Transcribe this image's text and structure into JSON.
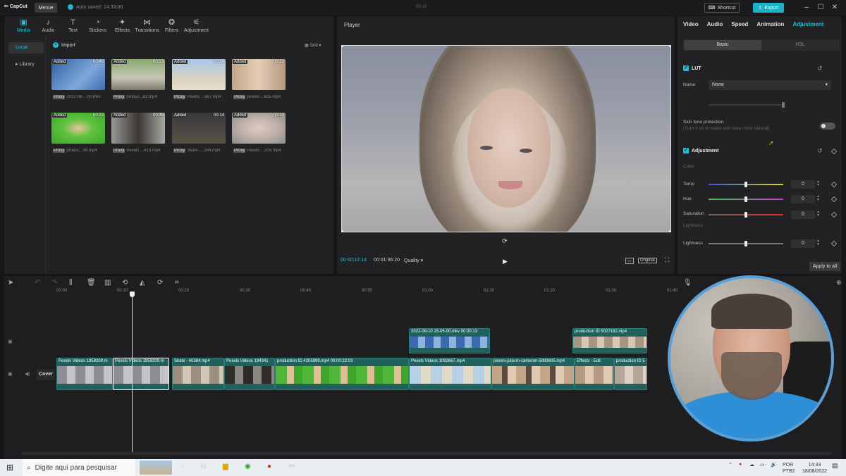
{
  "titlebar": {
    "app_name": "CapCut",
    "menu_label": "Menu",
    "autosave": "Auto saved: 14:33:00",
    "window_title": "00:13",
    "shortcut_label": "Shortcut",
    "export_label": "Export"
  },
  "tools": [
    {
      "icon": "media-icon",
      "label": "Media"
    },
    {
      "icon": "audio-icon",
      "label": "Audio"
    },
    {
      "icon": "text-icon",
      "label": "Text"
    },
    {
      "icon": "stickers-icon",
      "label": "Stickers"
    },
    {
      "icon": "effects-icon",
      "label": "Effects"
    },
    {
      "icon": "transitions-icon",
      "label": "Transitions"
    },
    {
      "icon": "filters-icon",
      "label": "Filters"
    },
    {
      "icon": "adjustment-icon",
      "label": "Adjustment"
    }
  ],
  "sidebar": {
    "local": "Local",
    "library": "Library"
  },
  "media": {
    "import_label": "Import",
    "view_label": "Grid",
    "items": [
      {
        "badge": "Added",
        "duration": "00:48",
        "proxy": "Proxy",
        "name": "2022-08-...00.mkv"
      },
      {
        "badge": "Added",
        "duration": "00:13",
        "proxy": "Proxy",
        "name": "produc...82.mp4"
      },
      {
        "badge": "Added",
        "duration": "00:14",
        "proxy": "Proxy",
        "name": "Pexels ...667.mp4"
      },
      {
        "badge": "Added",
        "duration": "00:22",
        "proxy": "Proxy",
        "name": "pexels-...605.mp4"
      },
      {
        "badge": "Added",
        "duration": "00:23",
        "proxy": "Proxy",
        "name": "produc...99.mp4"
      },
      {
        "badge": "Added",
        "duration": "00:39",
        "proxy": "Proxy",
        "name": "Pexels ...413.mp4"
      },
      {
        "badge": "Added",
        "duration": "00:14",
        "proxy": "Proxy",
        "name": "Skate -...384.mp4"
      },
      {
        "badge": "Added",
        "duration": "00:10",
        "proxy": "Proxy",
        "name": "Pexels ...209.mp4"
      }
    ]
  },
  "player": {
    "title": "Player",
    "current_time": "00:00:12:14",
    "total_time": "00:01:36:20",
    "quality": "Quality",
    "ratio_label": "Original"
  },
  "right": {
    "tabs": [
      "Video",
      "Audio",
      "Speed",
      "Animation",
      "Adjustment"
    ],
    "active_tab": "Adjustment",
    "subtabs": [
      "Basic",
      "HSL"
    ],
    "lut_title": "LUT",
    "name_label": "Name",
    "name_value": "None",
    "skin_title": "Skin tone protection",
    "skin_desc": "(Turn it on to make skin tone more natural)",
    "adj_title": "Adjustment",
    "color_label": "Color",
    "lightness_section": "Lightness",
    "controls": [
      {
        "label": "Temp",
        "value": "0"
      },
      {
        "label": "Hue",
        "value": "0"
      },
      {
        "label": "Saturation",
        "value": "0"
      },
      {
        "label": "Lightness",
        "value": "0"
      }
    ],
    "apply_all": "Apply to all"
  },
  "timeline": {
    "ruler": [
      "00:00",
      "00:10",
      "00:20",
      "00:30",
      "00:40",
      "00:50",
      "01:00",
      "01:10",
      "01:20",
      "01:30",
      "01:40"
    ],
    "cover_label": "Cover",
    "overlay_clips": [
      "2022-08-10 15-05-00.mkv  00:00:13",
      "production ID 5027182.mp4"
    ],
    "main_clips": [
      "Pexels Videos 1959209.m",
      "Pexels Videos 1959209.m",
      "Skate - 40384.mp4",
      "Pexels Videos 194341",
      "production ID 4205999.mp4  00:00:22:03",
      "Pexels Videos 1093667.mp4",
      "pexels-julia-m-cameron-5893605.mp4",
      "Effects - Edit",
      "production ID 5"
    ]
  },
  "taskbar": {
    "search_placeholder": "Digite aqui para pesquisar",
    "lang": "POR",
    "layout": "PTB2",
    "time": "14:33",
    "date": "18/08/2022"
  },
  "colors": {
    "accent": "#1fc0d4",
    "clip": "#21615d"
  }
}
